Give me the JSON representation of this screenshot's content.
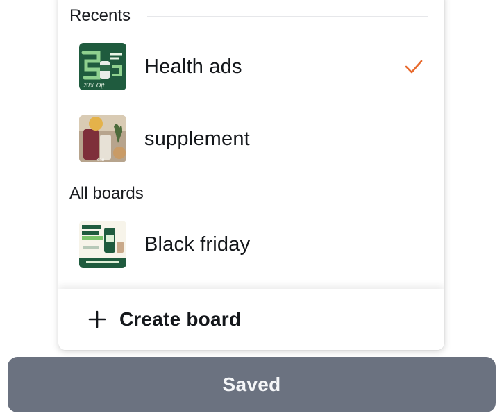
{
  "board_picker": {
    "recents_header": "Recents",
    "all_boards_header": "All boards",
    "recents": [
      {
        "label": "Health ads",
        "selected": true
      },
      {
        "label": "supplement",
        "selected": false
      }
    ],
    "all_boards": [
      {
        "label": "Black friday",
        "selected": false
      }
    ],
    "create_label": "Create board"
  },
  "save_button": {
    "label": "Saved"
  },
  "colors": {
    "check": "#e8692c",
    "saved_bg": "#6b7280",
    "thumb_green": "#1f5b3e"
  }
}
